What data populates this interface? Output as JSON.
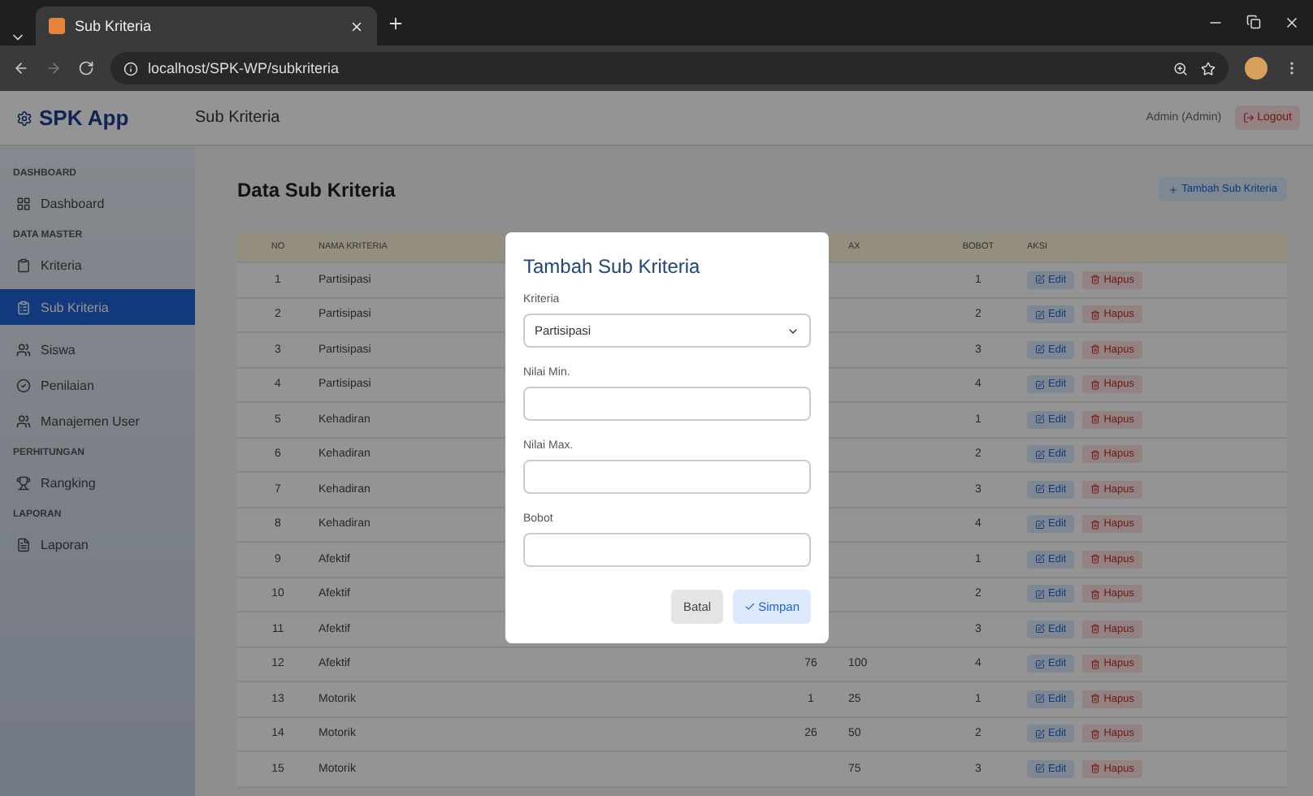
{
  "browser": {
    "tab_title": "Sub Kriteria",
    "url": "localhost/SPK-WP/subkriteria"
  },
  "brand": "SPK App",
  "sidebar": [
    {
      "heading": "DASHBOARD",
      "items": [
        {
          "label": "Dashboard",
          "selected": false
        }
      ]
    },
    {
      "heading": "DATA MASTER",
      "items": [
        {
          "label": "Kriteria",
          "selected": false
        },
        {
          "label": "Sub Kriteria",
          "selected": true
        },
        {
          "label": "Siswa",
          "selected": false
        },
        {
          "label": "Penilaian",
          "selected": false
        },
        {
          "label": "Manajemen User",
          "selected": false
        }
      ]
    },
    {
      "heading": "PERHITUNGAN",
      "items": [
        {
          "label": "Rangking",
          "selected": false
        }
      ]
    },
    {
      "heading": "LAPORAN",
      "items": [
        {
          "label": "Laporan",
          "selected": false
        }
      ]
    }
  ],
  "header": {
    "title": "Sub Kriteria",
    "user": "Admin (Admin)",
    "logout": "Logout"
  },
  "page_title": "Data Sub Kriteria",
  "add_button": "Tambah Sub Kriteria",
  "table": {
    "columns": [
      "NO",
      "NAMA KRITERIA",
      "",
      "AX",
      "BOBOT",
      "AKSI"
    ],
    "rows": [
      {
        "no": "1",
        "name": "Partisipasi",
        "bobot": "1",
        "edit": "Edit",
        "delete": "Hapus"
      },
      {
        "no": "2",
        "name": "Partisipasi",
        "bobot": "2",
        "edit": "Edit",
        "delete": "Hapus"
      },
      {
        "no": "3",
        "name": "Partisipasi",
        "bobot": "3",
        "edit": "Edit",
        "delete": "Hapus"
      },
      {
        "no": "4",
        "name": "Partisipasi",
        "bobot": "4",
        "edit": "Edit",
        "delete": "Hapus"
      },
      {
        "no": "5",
        "name": "Kehadiran",
        "bobot": "1",
        "edit": "Edit",
        "delete": "Hapus"
      },
      {
        "no": "6",
        "name": "Kehadiran",
        "bobot": "2",
        "edit": "Edit",
        "delete": "Hapus"
      },
      {
        "no": "7",
        "name": "Kehadiran",
        "bobot": "3",
        "edit": "Edit",
        "delete": "Hapus"
      },
      {
        "no": "8",
        "name": "Kehadiran",
        "bobot": "4",
        "edit": "Edit",
        "delete": "Hapus"
      },
      {
        "no": "9",
        "name": "Afektif",
        "bobot": "1",
        "edit": "Edit",
        "delete": "Hapus"
      },
      {
        "no": "10",
        "name": "Afektif",
        "bobot": "2",
        "edit": "Edit",
        "delete": "Hapus"
      },
      {
        "no": "11",
        "name": "Afektif",
        "bobot": "3",
        "edit": "Edit",
        "delete": "Hapus"
      },
      {
        "no": "12",
        "name": "Afektif",
        "min": "76",
        "max": "100",
        "bobot": "4",
        "edit": "Edit",
        "delete": "Hapus"
      },
      {
        "no": "13",
        "name": "Motorik",
        "min": "1",
        "max": "25",
        "bobot": "1",
        "edit": "Edit",
        "delete": "Hapus"
      },
      {
        "no": "14",
        "name": "Motorik",
        "min": "26",
        "max": "50",
        "bobot": "2",
        "edit": "Edit",
        "delete": "Hapus"
      },
      {
        "no": "15",
        "name": "Motorik",
        "max": "75",
        "bobot": "3",
        "edit": "Edit",
        "delete": "Hapus"
      }
    ]
  },
  "modal": {
    "title": "Tambah Sub Kriteria",
    "fields": [
      {
        "kind": "select",
        "label": "Kriteria",
        "value": "Partisipasi"
      },
      {
        "kind": "input",
        "label": "Nilai Min."
      },
      {
        "kind": "input",
        "label": "Nilai Max."
      },
      {
        "kind": "input",
        "label": "Bobot"
      }
    ],
    "cancel": "Batal",
    "save": "Simpan"
  }
}
